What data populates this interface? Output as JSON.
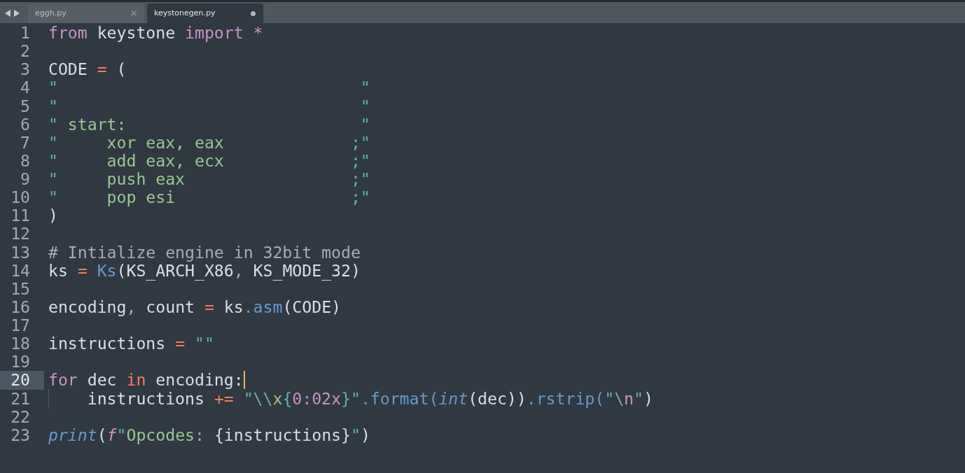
{
  "tabs": [
    {
      "label": "eggh.py",
      "selected": false,
      "modified": false
    },
    {
      "label": "keystonegen.py",
      "selected": true,
      "modified": true
    }
  ],
  "lines": [
    {
      "number": "1",
      "current": false,
      "indent_guide": false,
      "tokens": [
        {
          "kind": "keyword",
          "text": "from"
        },
        {
          "kind": "plain",
          "text": " keystone "
        },
        {
          "kind": "keyword",
          "text": "import *"
        }
      ]
    },
    {
      "number": "2",
      "current": false,
      "indent_guide": false
    },
    {
      "number": "3",
      "current": false,
      "indent_guide": false,
      "tokens": [
        {
          "kind": "plain",
          "text": "CODE "
        },
        {
          "kind": "op",
          "text": "="
        },
        {
          "kind": "plain",
          "text": " ("
        }
      ]
    },
    {
      "number": "4",
      "current": false,
      "indent_guide": false,
      "tokens": [
        {
          "kind": "quote",
          "text": "\"                               \""
        }
      ]
    },
    {
      "number": "5",
      "current": false,
      "indent_guide": false,
      "tokens": [
        {
          "kind": "quote",
          "text": "\"                               \""
        }
      ]
    },
    {
      "number": "6",
      "current": false,
      "indent_guide": false,
      "tokens": [
        {
          "kind": "quote",
          "text": "\""
        },
        {
          "kind": "string",
          "text": " start:                        "
        },
        {
          "kind": "quote",
          "text": "\""
        }
      ]
    },
    {
      "number": "7",
      "current": false,
      "indent_guide": false,
      "tokens": [
        {
          "kind": "quote",
          "text": "\""
        },
        {
          "kind": "string",
          "text": "     xor eax, eax             "
        },
        {
          "kind": "quote",
          "text": ";\""
        }
      ]
    },
    {
      "number": "8",
      "current": false,
      "indent_guide": false,
      "tokens": [
        {
          "kind": "quote",
          "text": "\""
        },
        {
          "kind": "string",
          "text": "     add eax, ecx             "
        },
        {
          "kind": "quote",
          "text": ";\""
        }
      ]
    },
    {
      "number": "9",
      "current": false,
      "indent_guide": false,
      "tokens": [
        {
          "kind": "quote",
          "text": "\""
        },
        {
          "kind": "string",
          "text": "     push eax                 "
        },
        {
          "kind": "quote",
          "text": ";\""
        }
      ]
    },
    {
      "number": "10",
      "current": false,
      "indent_guide": false,
      "tokens": [
        {
          "kind": "quote",
          "text": "\""
        },
        {
          "kind": "string",
          "text": "     pop esi                  "
        },
        {
          "kind": "quote",
          "text": ";\""
        }
      ]
    },
    {
      "number": "11",
      "current": false,
      "indent_guide": false,
      "tokens": [
        {
          "kind": "plain",
          "text": ")"
        }
      ]
    },
    {
      "number": "12",
      "current": false,
      "indent_guide": false
    },
    {
      "number": "13",
      "current": false,
      "indent_guide": false,
      "tokens": [
        {
          "kind": "comment",
          "text": "# Intialize engine in 32bit mode"
        }
      ]
    },
    {
      "number": "14",
      "current": false,
      "indent_guide": false,
      "tokens": [
        {
          "kind": "plain",
          "text": "ks "
        },
        {
          "kind": "op",
          "text": "= "
        },
        {
          "kind": "func",
          "text": "Ks"
        },
        {
          "kind": "plain",
          "text": "(KS_ARCH_X86"
        },
        {
          "kind": "punct",
          "text": ","
        },
        {
          "kind": "plain",
          "text": " KS_MODE_32)"
        }
      ]
    },
    {
      "number": "15",
      "current": false,
      "indent_guide": false
    },
    {
      "number": "16",
      "current": false,
      "indent_guide": false,
      "tokens": [
        {
          "kind": "plain",
          "text": "encoding"
        },
        {
          "kind": "punct",
          "text": ","
        },
        {
          "kind": "plain",
          "text": " count "
        },
        {
          "kind": "op",
          "text": "="
        },
        {
          "kind": "plain",
          "text": " ks"
        },
        {
          "kind": "func",
          "text": ".asm"
        },
        {
          "kind": "plain",
          "text": "(CODE)"
        }
      ]
    },
    {
      "number": "17",
      "current": false,
      "indent_guide": false
    },
    {
      "number": "18",
      "current": false,
      "indent_guide": false,
      "tokens": [
        {
          "kind": "plain",
          "text": "instructions "
        },
        {
          "kind": "op",
          "text": "= "
        },
        {
          "kind": "quote",
          "text": "\"\""
        }
      ]
    },
    {
      "number": "19",
      "current": false,
      "indent_guide": false
    },
    {
      "number": "20",
      "current": true,
      "indent_guide": false,
      "tokens": [
        {
          "kind": "keyword",
          "text": "for"
        },
        {
          "kind": "plain",
          "text": " dec "
        },
        {
          "kind": "op",
          "text": "in"
        },
        {
          "kind": "plain",
          "text": " encoding:"
        }
      ]
    },
    {
      "number": "21",
      "current": false,
      "indent_guide": true,
      "tokens": [
        {
          "kind": "plain",
          "text": "    instructions "
        },
        {
          "kind": "op",
          "text": "+= "
        },
        {
          "kind": "quote",
          "text": "\""
        },
        {
          "kind": "escape",
          "text": "\\\\"
        },
        {
          "kind": "string",
          "text": "x"
        },
        {
          "kind": "quote",
          "text": "{"
        },
        {
          "kind": "format",
          "text": "0:02x"
        },
        {
          "kind": "quote",
          "text": "}\""
        },
        {
          "kind": "func",
          "text": ".format("
        },
        {
          "kind": "builtin",
          "text": "int"
        },
        {
          "kind": "plain",
          "text": "(dec))"
        },
        {
          "kind": "func",
          "text": ".rstrip("
        },
        {
          "kind": "quote",
          "text": "\""
        },
        {
          "kind": "escape",
          "text": "\\"
        },
        {
          "kind": "format",
          "text": "n"
        },
        {
          "kind": "quote",
          "text": "\""
        },
        {
          "kind": "plain",
          "text": ")"
        }
      ]
    },
    {
      "number": "22",
      "current": false,
      "indent_guide": false
    },
    {
      "number": "23",
      "current": false,
      "indent_guide": false,
      "tokens": [
        {
          "kind": "builtin",
          "text": "print"
        },
        {
          "kind": "plain",
          "text": "("
        },
        {
          "kind": "storage",
          "text": "f"
        },
        {
          "kind": "quote",
          "text": "\""
        },
        {
          "kind": "string",
          "text": "Opcodes"
        },
        {
          "kind": "punct",
          "text": ":"
        },
        {
          "kind": "plain",
          "text": " {instructions}"
        },
        {
          "kind": "quote",
          "text": "\""
        },
        {
          "kind": "plain",
          "text": ")"
        }
      ]
    }
  ]
}
